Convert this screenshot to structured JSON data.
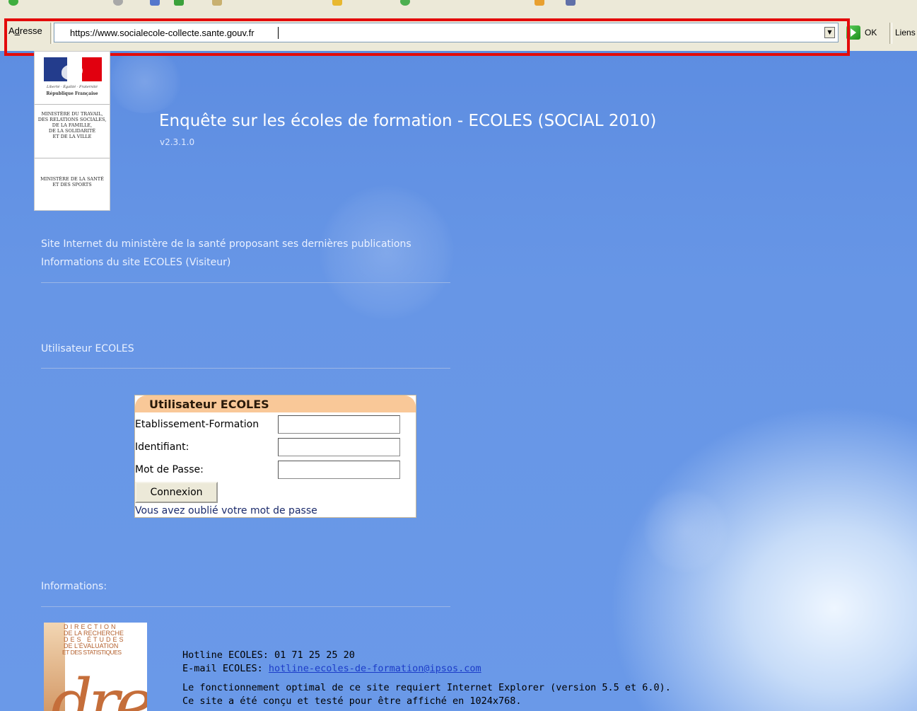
{
  "browser": {
    "address_label": "Adresse",
    "url": "https://www.socialecole-collecte.sante.gouv.fr",
    "go_label": "OK",
    "links_label": "Liens"
  },
  "logo": {
    "motto": "Liberté · Égalité · Fraternité",
    "republic": "République Française",
    "ministry1": [
      "MINISTÈRE DU TRAVAIL,",
      "DES RELATIONS SOCIALES,",
      "DE LA FAMILLE,",
      "DE LA SOLIDARITÉ",
      "ET DE LA VILLE"
    ],
    "ministry2": [
      "MINISTÈRE DE LA SANTÉ",
      "ET DES SPORTS"
    ]
  },
  "header": {
    "title": "Enquête sur les écoles de formation  - ECOLES (SOCIAL 2010)",
    "version": "v2.3.1.0"
  },
  "links": {
    "ministry_site": "Site Internet du ministère de la santé proposant ses dernières publications",
    "visitor_info": "Informations du site ECOLES (Visiteur)"
  },
  "sections": {
    "user": "Utilisateur ECOLES",
    "informations": "Informations:"
  },
  "login": {
    "title": "Utilisateur ECOLES",
    "establishment_label": "Etablissement-Formation",
    "establishment_value": "",
    "identifier_label": "Identifiant:",
    "identifier_value": "",
    "password_label": "Mot de Passe:",
    "password_value": "",
    "submit_label": "Connexion",
    "forgot_link": "Vous avez oublié votre mot de passe"
  },
  "drees": {
    "lines": [
      "DIRECTION",
      "DE LA RECHERCHE",
      "DES ÉTUDES",
      "DE L'ÉVALUATION",
      "ET DES STATISTIQUES"
    ],
    "word": "drees"
  },
  "footer": {
    "hotline": "Hotline ECOLES: 01 71 25 25 20",
    "email_label": "E-mail ECOLES: ",
    "email": "hotline-ecoles-de-formation@ipsos.com",
    "browser_note": "Le fonctionnement optimal de ce site requiert Internet Explorer (version 5.5 et 6.0).",
    "resolution_note": "Ce site a été conçu et testé pour être affiché en 1024x768."
  }
}
